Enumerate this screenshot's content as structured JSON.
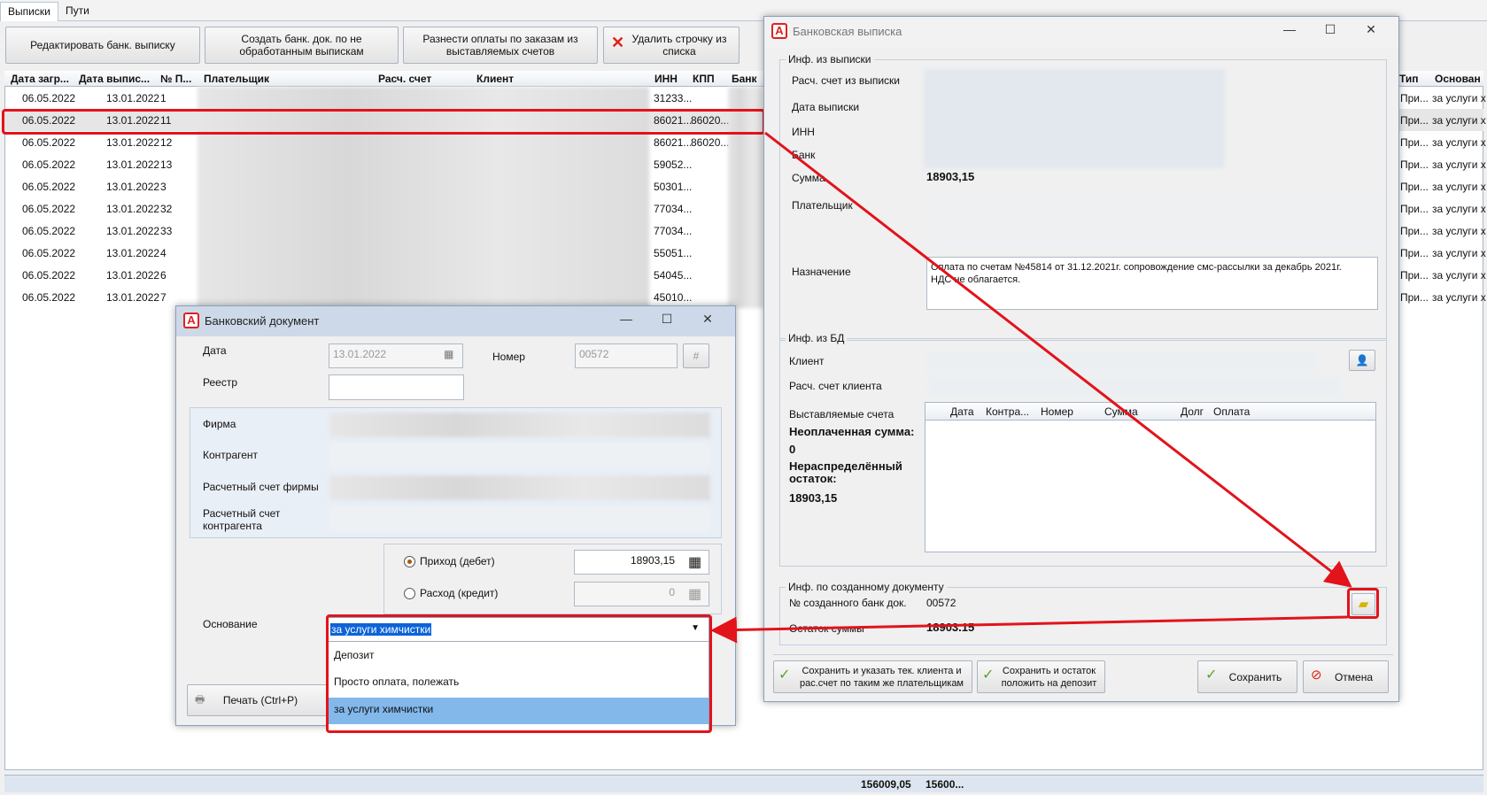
{
  "tabs": [
    "Выписки",
    "Пути"
  ],
  "toolbar": {
    "edit": "Редактировать банк. выписку",
    "create": "Создать банк. док. по не обработанным выпискам",
    "distribute": "Разнести оплаты по заказам из выставляемых счетов",
    "delete": "Удалить строчку из списка"
  },
  "grid": {
    "headers": [
      "Дата загр...",
      "Дата выпис...",
      "№ П...",
      "Плательщик",
      "Расч. счет",
      "Клиент",
      "ИНН",
      "КПП",
      "Банк",
      "Тип",
      "Основан"
    ],
    "rows": [
      [
        "06.05.2022",
        "13.01.2022",
        "1",
        "31233...",
        "",
        "При...",
        "за услуги х"
      ],
      [
        "06.05.2022",
        "13.01.2022",
        "11",
        "86021...",
        "86020...",
        "При...",
        "за услуги х"
      ],
      [
        "06.05.2022",
        "13.01.2022",
        "12",
        "86021...",
        "86020...",
        "При...",
        "за услуги х"
      ],
      [
        "06.05.2022",
        "13.01.2022",
        "13",
        "59052...",
        "",
        "При...",
        "за услуги х"
      ],
      [
        "06.05.2022",
        "13.01.2022",
        "3",
        "50301...",
        "",
        "При...",
        "за услуги х"
      ],
      [
        "06.05.2022",
        "13.01.2022",
        "32",
        "77034...",
        "",
        "При...",
        "за услуги х"
      ],
      [
        "06.05.2022",
        "13.01.2022",
        "33",
        "77034...",
        "",
        "При...",
        "за услуги х"
      ],
      [
        "06.05.2022",
        "13.01.2022",
        "4",
        "55051...",
        "",
        "При...",
        "за услуги х"
      ],
      [
        "06.05.2022",
        "13.01.2022",
        "6",
        "54045...",
        "",
        "При...",
        "за услуги х"
      ],
      [
        "06.05.2022",
        "13.01.2022",
        "7",
        "45010...",
        "",
        "При...",
        "за услуги х"
      ]
    ],
    "footer_total1": "156009,05",
    "footer_total2": "15600..."
  },
  "bank_doc": {
    "title": "Банковский документ",
    "date_label": "Дата",
    "date_value": "13.01.2022",
    "number_label": "Номер",
    "number_value": "00572",
    "registry_label": "Реестр",
    "firm_label": "Фирма",
    "counterparty_label": "Контрагент",
    "firm_account_label": "Расчетный счет фирмы",
    "cp_account_label": "Расчетный счет контрагента",
    "income_label": "Приход (дебет)",
    "income_value": "18903,15",
    "expense_label": "Расход (кредит)",
    "expense_value": "0",
    "basis_label": "Основание",
    "basis_value": "за услуги химчистки",
    "options": [
      "Депозит",
      "Просто оплата, полежать",
      "за услуги химчистки"
    ],
    "print_label": "Печать (Ctrl+P)"
  },
  "statement": {
    "title": "Банковская выписка",
    "info_group": "Инф. из выписки",
    "account_label": "Расч. счет из выписки",
    "date_label": "Дата выписки",
    "inn_label": "ИНН",
    "bank_label": "Банк",
    "sum_label": "Сумма",
    "sum_value": "18903,15",
    "payer_label": "Плательщик",
    "purpose_label": "Назначение",
    "purpose_value": "Оплата по счетам №45814 от 31.12.2021г. сопровождение смс-рассылки за декабрь 2021г.  НДС не облагается.",
    "db_group": "Инф. из БД",
    "client_label": "Клиент",
    "client_account_label": "Расч. счет клиента",
    "invoices_label": "Выставляемые счета",
    "invoice_cols": [
      "Дата",
      "Контра...",
      "Номер",
      "Сумма",
      "Долг",
      "Оплата"
    ],
    "unpaid_label": "Неоплаченная сумма:",
    "unpaid_value": "0",
    "rest_label": "Нераспределённый остаток:",
    "rest_value": "18903,15",
    "created_group": "Инф. по созданному документу",
    "created_no_label": "№ созданного банк док.",
    "created_no_value": "00572",
    "rest_sum_label": "Остаток суммы",
    "rest_sum_value": "18903.15",
    "btn_save_client": "Сохранить и указать тек. клиента и рас.счет по таким же плательщикам",
    "btn_save_deposit": "Сохранить и остаток положить на депозит",
    "btn_save": "Сохранить",
    "btn_cancel": "Отмена"
  }
}
